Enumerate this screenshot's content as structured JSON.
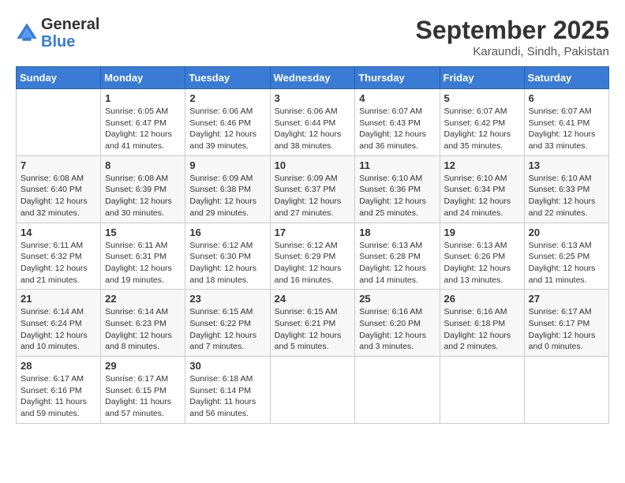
{
  "header": {
    "logo_general": "General",
    "logo_blue": "Blue",
    "month": "September 2025",
    "location": "Karaundi, Sindh, Pakistan"
  },
  "days_of_week": [
    "Sunday",
    "Monday",
    "Tuesday",
    "Wednesday",
    "Thursday",
    "Friday",
    "Saturday"
  ],
  "weeks": [
    [
      {
        "day": "",
        "info": ""
      },
      {
        "day": "1",
        "info": "Sunrise: 6:05 AM\nSunset: 6:47 PM\nDaylight: 12 hours\nand 41 minutes."
      },
      {
        "day": "2",
        "info": "Sunrise: 6:06 AM\nSunset: 6:46 PM\nDaylight: 12 hours\nand 39 minutes."
      },
      {
        "day": "3",
        "info": "Sunrise: 6:06 AM\nSunset: 6:44 PM\nDaylight: 12 hours\nand 38 minutes."
      },
      {
        "day": "4",
        "info": "Sunrise: 6:07 AM\nSunset: 6:43 PM\nDaylight: 12 hours\nand 36 minutes."
      },
      {
        "day": "5",
        "info": "Sunrise: 6:07 AM\nSunset: 6:42 PM\nDaylight: 12 hours\nand 35 minutes."
      },
      {
        "day": "6",
        "info": "Sunrise: 6:07 AM\nSunset: 6:41 PM\nDaylight: 12 hours\nand 33 minutes."
      }
    ],
    [
      {
        "day": "7",
        "info": "Sunrise: 6:08 AM\nSunset: 6:40 PM\nDaylight: 12 hours\nand 32 minutes."
      },
      {
        "day": "8",
        "info": "Sunrise: 6:08 AM\nSunset: 6:39 PM\nDaylight: 12 hours\nand 30 minutes."
      },
      {
        "day": "9",
        "info": "Sunrise: 6:09 AM\nSunset: 6:38 PM\nDaylight: 12 hours\nand 29 minutes."
      },
      {
        "day": "10",
        "info": "Sunrise: 6:09 AM\nSunset: 6:37 PM\nDaylight: 12 hours\nand 27 minutes."
      },
      {
        "day": "11",
        "info": "Sunrise: 6:10 AM\nSunset: 6:36 PM\nDaylight: 12 hours\nand 25 minutes."
      },
      {
        "day": "12",
        "info": "Sunrise: 6:10 AM\nSunset: 6:34 PM\nDaylight: 12 hours\nand 24 minutes."
      },
      {
        "day": "13",
        "info": "Sunrise: 6:10 AM\nSunset: 6:33 PM\nDaylight: 12 hours\nand 22 minutes."
      }
    ],
    [
      {
        "day": "14",
        "info": "Sunrise: 6:11 AM\nSunset: 6:32 PM\nDaylight: 12 hours\nand 21 minutes."
      },
      {
        "day": "15",
        "info": "Sunrise: 6:11 AM\nSunset: 6:31 PM\nDaylight: 12 hours\nand 19 minutes."
      },
      {
        "day": "16",
        "info": "Sunrise: 6:12 AM\nSunset: 6:30 PM\nDaylight: 12 hours\nand 18 minutes."
      },
      {
        "day": "17",
        "info": "Sunrise: 6:12 AM\nSunset: 6:29 PM\nDaylight: 12 hours\nand 16 minutes."
      },
      {
        "day": "18",
        "info": "Sunrise: 6:13 AM\nSunset: 6:28 PM\nDaylight: 12 hours\nand 14 minutes."
      },
      {
        "day": "19",
        "info": "Sunrise: 6:13 AM\nSunset: 6:26 PM\nDaylight: 12 hours\nand 13 minutes."
      },
      {
        "day": "20",
        "info": "Sunrise: 6:13 AM\nSunset: 6:25 PM\nDaylight: 12 hours\nand 11 minutes."
      }
    ],
    [
      {
        "day": "21",
        "info": "Sunrise: 6:14 AM\nSunset: 6:24 PM\nDaylight: 12 hours\nand 10 minutes."
      },
      {
        "day": "22",
        "info": "Sunrise: 6:14 AM\nSunset: 6:23 PM\nDaylight: 12 hours\nand 8 minutes."
      },
      {
        "day": "23",
        "info": "Sunrise: 6:15 AM\nSunset: 6:22 PM\nDaylight: 12 hours\nand 7 minutes."
      },
      {
        "day": "24",
        "info": "Sunrise: 6:15 AM\nSunset: 6:21 PM\nDaylight: 12 hours\nand 5 minutes."
      },
      {
        "day": "25",
        "info": "Sunrise: 6:16 AM\nSunset: 6:20 PM\nDaylight: 12 hours\nand 3 minutes."
      },
      {
        "day": "26",
        "info": "Sunrise: 6:16 AM\nSunset: 6:18 PM\nDaylight: 12 hours\nand 2 minutes."
      },
      {
        "day": "27",
        "info": "Sunrise: 6:17 AM\nSunset: 6:17 PM\nDaylight: 12 hours\nand 0 minutes."
      }
    ],
    [
      {
        "day": "28",
        "info": "Sunrise: 6:17 AM\nSunset: 6:16 PM\nDaylight: 11 hours\nand 59 minutes."
      },
      {
        "day": "29",
        "info": "Sunrise: 6:17 AM\nSunset: 6:15 PM\nDaylight: 11 hours\nand 57 minutes."
      },
      {
        "day": "30",
        "info": "Sunrise: 6:18 AM\nSunset: 6:14 PM\nDaylight: 11 hours\nand 56 minutes."
      },
      {
        "day": "",
        "info": ""
      },
      {
        "day": "",
        "info": ""
      },
      {
        "day": "",
        "info": ""
      },
      {
        "day": "",
        "info": ""
      }
    ]
  ]
}
